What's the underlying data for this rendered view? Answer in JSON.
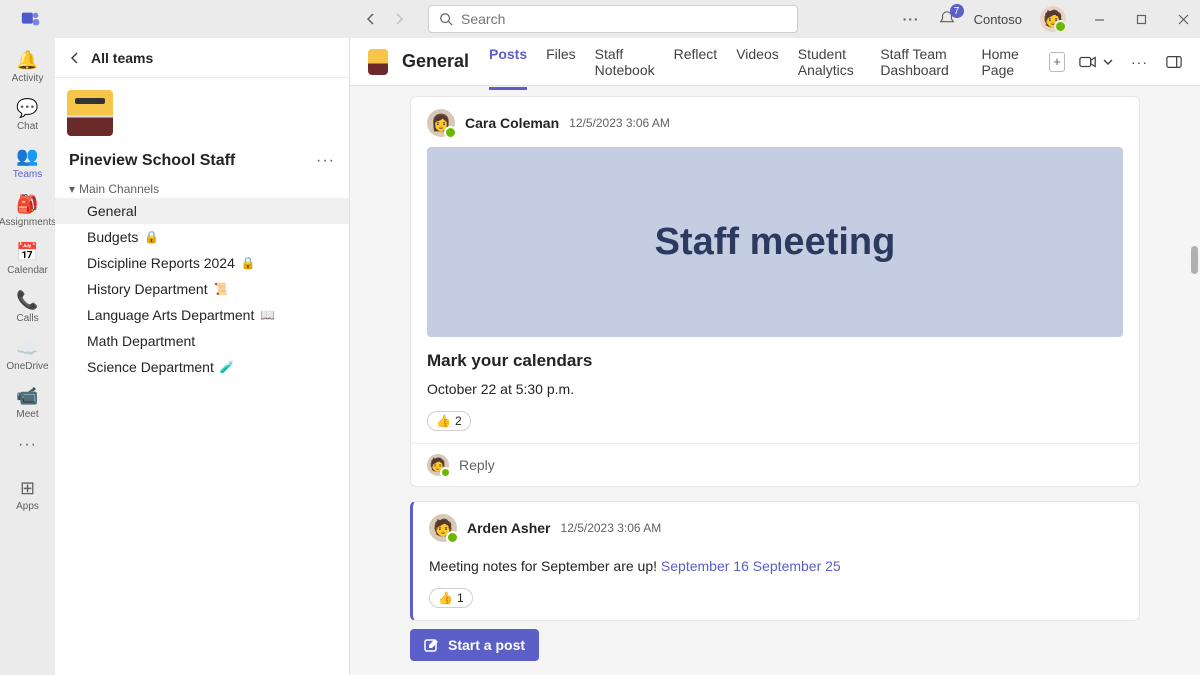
{
  "titlebar": {
    "search_placeholder": "Search",
    "notification_count": "7",
    "profile_name": "Contoso"
  },
  "rail": {
    "items": [
      {
        "label": "Activity"
      },
      {
        "label": "Chat"
      },
      {
        "label": "Teams"
      },
      {
        "label": "Assignments"
      },
      {
        "label": "Calendar"
      },
      {
        "label": "Calls"
      },
      {
        "label": "OneDrive"
      },
      {
        "label": "Meet"
      }
    ],
    "apps_label": "Apps"
  },
  "sidebar": {
    "all_teams": "All teams",
    "team_name": "Pineview School Staff",
    "section_label": "Main Channels",
    "channels": [
      {
        "name": "General",
        "icon": ""
      },
      {
        "name": "Budgets",
        "icon": "🔒"
      },
      {
        "name": "Discipline Reports 2024",
        "icon": "🔒"
      },
      {
        "name": "History Department",
        "icon": "📜"
      },
      {
        "name": "Language Arts Department",
        "icon": "📖"
      },
      {
        "name": "Math Department",
        "icon": ""
      },
      {
        "name": "Science Department",
        "icon": "🧪"
      }
    ]
  },
  "header": {
    "channel_name": "General",
    "tabs": [
      {
        "label": "Posts"
      },
      {
        "label": "Files"
      },
      {
        "label": "Staff Notebook"
      },
      {
        "label": "Reflect"
      },
      {
        "label": "Videos"
      },
      {
        "label": "Student Analytics"
      },
      {
        "label": "Staff Team Dashboard"
      },
      {
        "label": "Home Page"
      }
    ]
  },
  "posts": [
    {
      "author": "Cara Coleman",
      "timestamp": "12/5/2023 3:06 AM",
      "banner_text": "Staff meeting",
      "title": "Mark your calendars",
      "body": "October 22 at 5:30 p.m.",
      "reaction_count": "2",
      "reaction_emoji": "👍",
      "reply_label": "Reply"
    },
    {
      "author": "Arden Asher",
      "timestamp": "12/5/2023 3:06 AM",
      "body_prefix": "Meeting notes for September are up! ",
      "link1": "September 16",
      "link2": "September 25",
      "reaction_count": "1",
      "reaction_emoji": "👍"
    }
  ],
  "compose": {
    "start_post": "Start a post"
  }
}
